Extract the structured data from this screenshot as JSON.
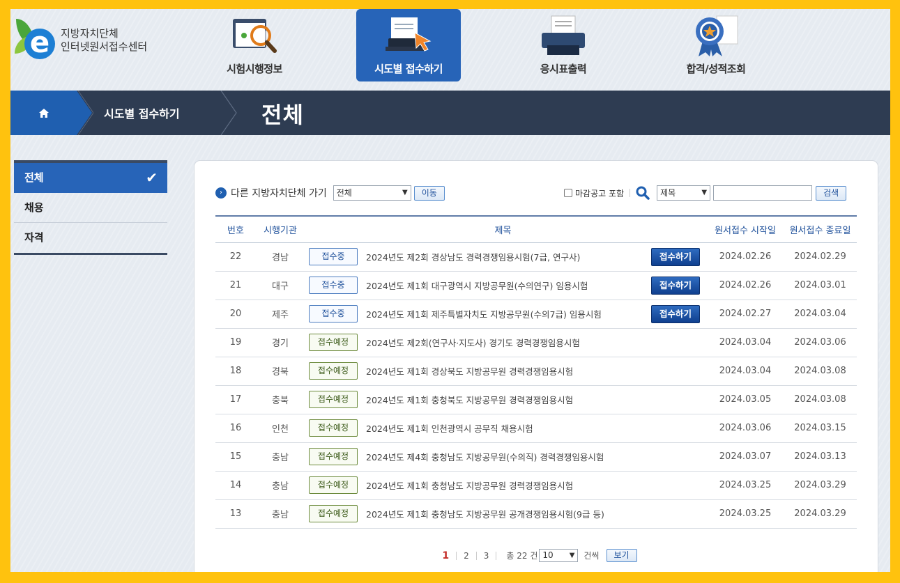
{
  "logo": {
    "line1": "지방자치단체",
    "line2": "인터넷원서접수센터",
    "letter": "e"
  },
  "nav": [
    {
      "label": "시험시행정보"
    },
    {
      "label": "시도별 접수하기"
    },
    {
      "label": "응시표출력"
    },
    {
      "label": "합격/성적조회"
    }
  ],
  "breadcrumb": {
    "section": "시도별 접수하기",
    "current": "전체"
  },
  "sidebar": {
    "items": [
      {
        "label": "전체"
      },
      {
        "label": "채용"
      },
      {
        "label": "자격"
      }
    ],
    "check": "✔"
  },
  "toolbar": {
    "goto_label": "다른 지방자치단체 가기",
    "region_select": "전체",
    "move_button": "이동",
    "include_closed_label": "마감공고 포함",
    "search_field_select": "제목",
    "search_placeholder": "",
    "search_button": "검색"
  },
  "table": {
    "headers": [
      "번호",
      "시행기관",
      "",
      "제목",
      "",
      "원서접수 시작일",
      "원서접수 종료일"
    ],
    "apply_label": "접수하기",
    "rows": [
      {
        "no": "22",
        "org": "경남",
        "status": "접수중",
        "title": "2024년도 제2회 경상남도 경력경쟁임용시험(7급, 연구사)",
        "start": "2024.02.26",
        "end": "2024.02.29",
        "apply": true
      },
      {
        "no": "21",
        "org": "대구",
        "status": "접수중",
        "title": "2024년도 제1회 대구광역시 지방공무원(수의연구) 임용시험",
        "start": "2024.02.26",
        "end": "2024.03.01",
        "apply": true
      },
      {
        "no": "20",
        "org": "제주",
        "status": "접수중",
        "title": "2024년도 제1회 제주특별자치도 지방공무원(수의7급) 임용시험",
        "start": "2024.02.27",
        "end": "2024.03.04",
        "apply": true
      },
      {
        "no": "19",
        "org": "경기",
        "status": "접수예정",
        "title": "2024년도 제2회(연구사·지도사) 경기도 경력경쟁임용시험",
        "start": "2024.03.04",
        "end": "2024.03.06",
        "apply": false
      },
      {
        "no": "18",
        "org": "경북",
        "status": "접수예정",
        "title": "2024년도 제1회 경상북도 지방공무원 경력경쟁임용시험",
        "start": "2024.03.04",
        "end": "2024.03.08",
        "apply": false
      },
      {
        "no": "17",
        "org": "충북",
        "status": "접수예정",
        "title": "2024년도 제1회 충청북도 지방공무원 경력경쟁임용시험",
        "start": "2024.03.05",
        "end": "2024.03.08",
        "apply": false
      },
      {
        "no": "16",
        "org": "인천",
        "status": "접수예정",
        "title": "2024년도 제1회 인천광역시 공무직 채용시험",
        "start": "2024.03.06",
        "end": "2024.03.15",
        "apply": false
      },
      {
        "no": "15",
        "org": "충남",
        "status": "접수예정",
        "title": "2024년도 제4회 충청남도 지방공무원(수의직) 경력경쟁임용시험",
        "start": "2024.03.07",
        "end": "2024.03.13",
        "apply": false
      },
      {
        "no": "14",
        "org": "충남",
        "status": "접수예정",
        "title": "2024년도 제1회 충청남도 지방공무원 경력경쟁임용시험",
        "start": "2024.03.25",
        "end": "2024.03.29",
        "apply": false
      },
      {
        "no": "13",
        "org": "충남",
        "status": "접수예정",
        "title": "2024년도 제1회 충청남도 지방공무원 공개경쟁임용시험(9급 등)",
        "start": "2024.03.25",
        "end": "2024.03.29",
        "apply": false
      }
    ]
  },
  "pagination": {
    "pages": [
      "1",
      "2",
      "3"
    ],
    "current": "1",
    "total_label": "총 22 건",
    "per_page": "10",
    "per_page_suffix": "건씩",
    "view_button": "보기"
  },
  "colors": {
    "accent": "#2764b8",
    "frame": "#ffc20e",
    "breadcrumb_bg": "#2e3c52"
  }
}
